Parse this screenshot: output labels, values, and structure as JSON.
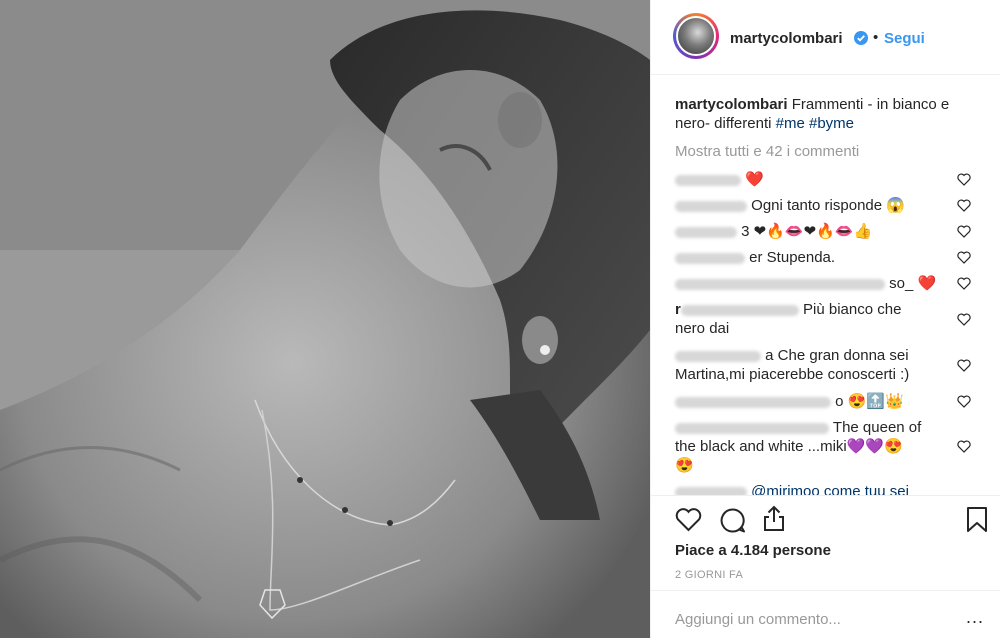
{
  "post": {
    "username": "martycolombari",
    "dot": "•",
    "follow_label": "Segui",
    "caption_text": "Frammenti - in bianco e nero- differenti",
    "caption_tags": [
      "#me",
      "#byme"
    ],
    "show_all_label": "Mostra tutti e 42 i commenti",
    "comments": [
      {
        "visible_text": "❤️"
      },
      {
        "visible_text": "Ogni tanto risponde 😱"
      },
      {
        "visible_text": "3 ❤🔥👄❤🔥👄👍"
      },
      {
        "visible_text": "er Stupenda."
      },
      {
        "visible_text": "so_ ❤️"
      },
      {
        "prefix": "r",
        "line1": "Più bianco che",
        "line2": "nero dai"
      },
      {
        "line1": "a Che gran donna sei",
        "line2": "Martina,mi piacerebbe conoscerti :)"
      },
      {
        "visible_text": "o 😍🔝👑"
      },
      {
        "line1": "The queen of",
        "line2": "the black and white ...miki💜💜😍",
        "line3": "😍"
      },
      {
        "visible_text": "@mirimoo come tuu sei"
      }
    ],
    "likes_text": "Piace a 4.184 persone",
    "time_text": "2 GIORNI FA",
    "add_comment_placeholder": "Aggiungi un commento...",
    "more_label": "..."
  },
  "colors": {
    "link": "#3897f0",
    "hashtag": "#003569",
    "muted": "#999999",
    "verified": "#3897f0"
  },
  "icons": [
    "heart-icon",
    "comment-icon",
    "share-icon",
    "bookmark-icon",
    "verified-badge-icon",
    "comment-like-icon"
  ]
}
